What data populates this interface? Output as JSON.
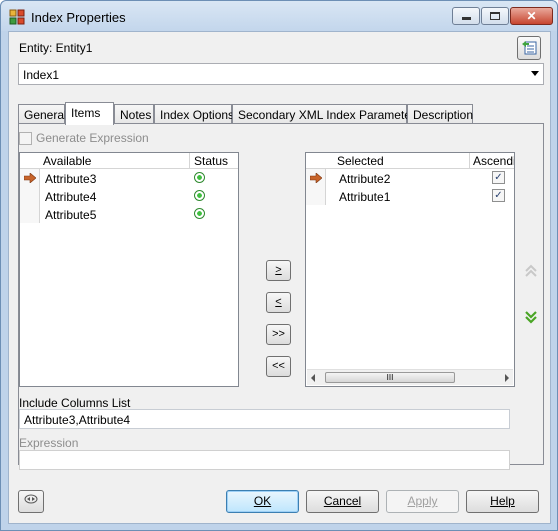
{
  "window": {
    "title": "Index Properties"
  },
  "entity": {
    "label": "Entity: Entity1"
  },
  "index_combo": {
    "value": "Index1"
  },
  "tabs": [
    {
      "label": "General"
    },
    {
      "label": "Items"
    },
    {
      "label": "Notes"
    },
    {
      "label": "Index Options"
    },
    {
      "label": "Secondary XML Index Parameters"
    },
    {
      "label": "Description"
    }
  ],
  "active_tab": "Items",
  "generate_expression": {
    "label": "Generate Expression",
    "checked": false,
    "enabled": false
  },
  "available": {
    "headers": {
      "name": "Available",
      "status": "Status"
    },
    "rows": [
      {
        "name": "Attribute3",
        "selected": true
      },
      {
        "name": "Attribute4",
        "selected": false
      },
      {
        "name": "Attribute5",
        "selected": false
      }
    ]
  },
  "move_buttons": {
    "add": ">",
    "remove": "<",
    "add_all": ">>",
    "remove_all": "<<"
  },
  "selected": {
    "headers": {
      "name": "Selected",
      "ascending": "Ascendin"
    },
    "rows": [
      {
        "name": "Attribute2",
        "ascending": true,
        "selected": true
      },
      {
        "name": "Attribute1",
        "ascending": true,
        "selected": false
      }
    ],
    "scroll_thumb": "III"
  },
  "include_columns": {
    "label": "Include Columns List",
    "value": "Attribute3,Attribute4"
  },
  "expression": {
    "label": "Expression",
    "value": ""
  },
  "buttons": {
    "ok": "OK",
    "cancel": "Cancel",
    "apply": "Apply",
    "help": "Help"
  },
  "icons": [
    "app-icon",
    "minimize-icon",
    "maximize-icon",
    "close-icon",
    "entity-editor-icon",
    "row-pointer-icon",
    "status-icon",
    "move-up-icon",
    "move-down-icon",
    "toggle-icon"
  ],
  "colors": {
    "accent_green": "#2f9a2f",
    "pointer_orange": "#c8642a",
    "default_button": "#3c7fb1"
  }
}
